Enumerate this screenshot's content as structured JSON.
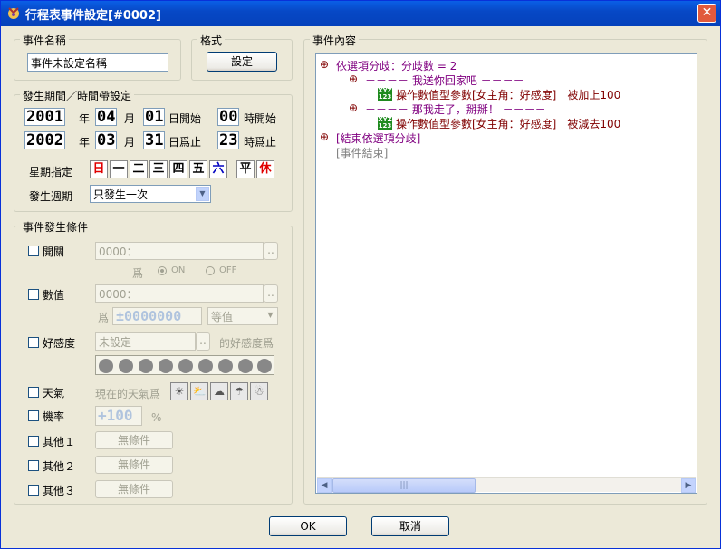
{
  "window": {
    "title": "行程表事件設定[#0002]",
    "close_glyph": "✕"
  },
  "event_name": {
    "legend": "事件名稱",
    "value": "事件未設定名稱"
  },
  "format": {
    "legend": "格式",
    "button": "設定"
  },
  "period": {
    "legend": "發生期間／時間帶設定",
    "start": {
      "year": "2001",
      "year_unit": "年",
      "month": "04",
      "month_unit": "月",
      "day": "01",
      "day_unit": "日開始",
      "hour": "00",
      "hour_unit": "時開始"
    },
    "end": {
      "year": "2002",
      "year_unit": "年",
      "month": "03",
      "month_unit": "月",
      "day": "31",
      "day_unit": "日爲止",
      "hour": "23",
      "hour_unit": "時爲止"
    },
    "weekday_label": "星期指定",
    "weekdays": [
      "日",
      "一",
      "二",
      "三",
      "四",
      "五",
      "六"
    ],
    "weekday_colors": [
      "#E00000",
      "#000000",
      "#000000",
      "#000000",
      "#000000",
      "#000000",
      "#0000C0"
    ],
    "weekday_extra": [
      "平",
      "休"
    ],
    "cycle_label": "發生週期",
    "cycle_value": "只發生一次"
  },
  "conditions": {
    "legend": "事件發生條件",
    "switch": {
      "label": "開關",
      "value": "0000：",
      "is_label": "爲",
      "on": "ON",
      "off": "OFF"
    },
    "number": {
      "label": "數值",
      "value": "0000：",
      "is_label": "爲",
      "amount": "±0000000",
      "compare": "等值"
    },
    "affection": {
      "label": "好感度",
      "value": "未設定",
      "suffix": "的好感度爲"
    },
    "weather": {
      "label": "天氣",
      "prefix": "現在的天氣爲"
    },
    "probability": {
      "label": "機率",
      "value": "+100",
      "unit": "%"
    },
    "other1": {
      "label": "其他１",
      "button": "無條件"
    },
    "other2": {
      "label": "其他２",
      "button": "無條件"
    },
    "other3": {
      "label": "其他３",
      "button": "無條件"
    }
  },
  "content": {
    "legend": "事件內容",
    "lines": [
      "依選項分歧：分歧數 = 2",
      "－－－－ 我送你回家吧 －－－－",
      "操作數值型參數[女主角：好感度]　被加上100",
      "－－－－ 那我走了，掰掰！ －－－－",
      "操作數值型參數[女主角：好感度]　被減去100",
      "[結束依選項分歧]",
      "[事件結束]"
    ],
    "var_icon_text": "XYZ 123"
  },
  "footer": {
    "ok": "OK",
    "cancel": "取消"
  }
}
